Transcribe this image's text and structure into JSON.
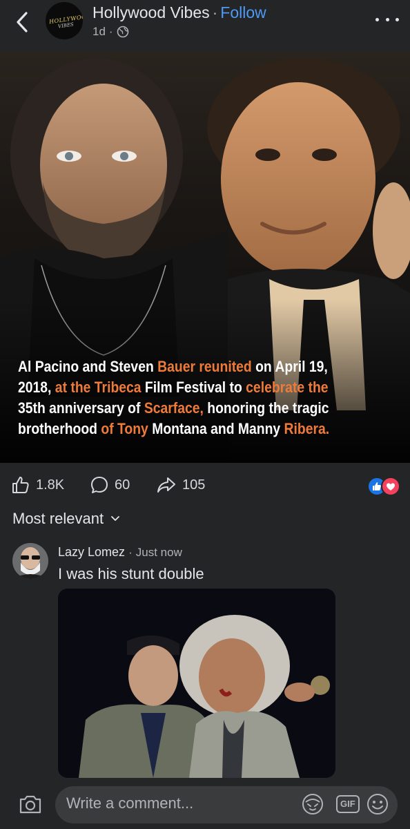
{
  "header": {
    "page_name": "Hollywood Vibes",
    "separator": "·",
    "follow_label": "Follow",
    "age": "1d",
    "meta_separator": "·",
    "avatar_logo_text": "HOLLYWOOD",
    "avatar_logo_sub": "VIBES",
    "icons": {
      "back": "chevron-left-icon",
      "privacy": "globe-icon",
      "more": "more-dots-icon"
    }
  },
  "post": {
    "caption": {
      "line1": [
        {
          "t": "Al Pacino and Steven ",
          "hl": false
        },
        {
          "t": "Bauer reunited",
          "hl": true
        },
        {
          "t": " on April 19,",
          "hl": false
        }
      ],
      "line2": [
        {
          "t": "2018, ",
          "hl": false
        },
        {
          "t": "at the Tribeca",
          "hl": true
        },
        {
          "t": " Film Festival to ",
          "hl": false
        },
        {
          "t": "celebrate the",
          "hl": true
        }
      ],
      "line3": [
        {
          "t": "35th anniversary of ",
          "hl": false
        },
        {
          "t": "Scarface,",
          "hl": true
        },
        {
          "t": " honoring the tragic",
          "hl": false
        }
      ],
      "line4": [
        {
          "t": "brotherhood ",
          "hl": false
        },
        {
          "t": "of Tony",
          "hl": true
        },
        {
          "t": " Montana and Manny ",
          "hl": false
        },
        {
          "t": "Ribera.",
          "hl": true
        }
      ]
    },
    "highlight_color": "#ef7b3a"
  },
  "actions": {
    "likes": "1.8K",
    "comments": "60",
    "shares": "105",
    "reactions": [
      "like",
      "love"
    ]
  },
  "comments_section": {
    "sort_label": "Most relevant",
    "comment": {
      "author": "Lazy Lomez",
      "separator": "·",
      "time": "Just now",
      "text": "I was his stunt double"
    }
  },
  "composer": {
    "placeholder": "Write a comment...",
    "gif_label": "GIF"
  },
  "colors": {
    "background": "#242526",
    "link": "#4e9af6",
    "like_blue": "#1b74e4",
    "love_red": "#f3425f"
  }
}
